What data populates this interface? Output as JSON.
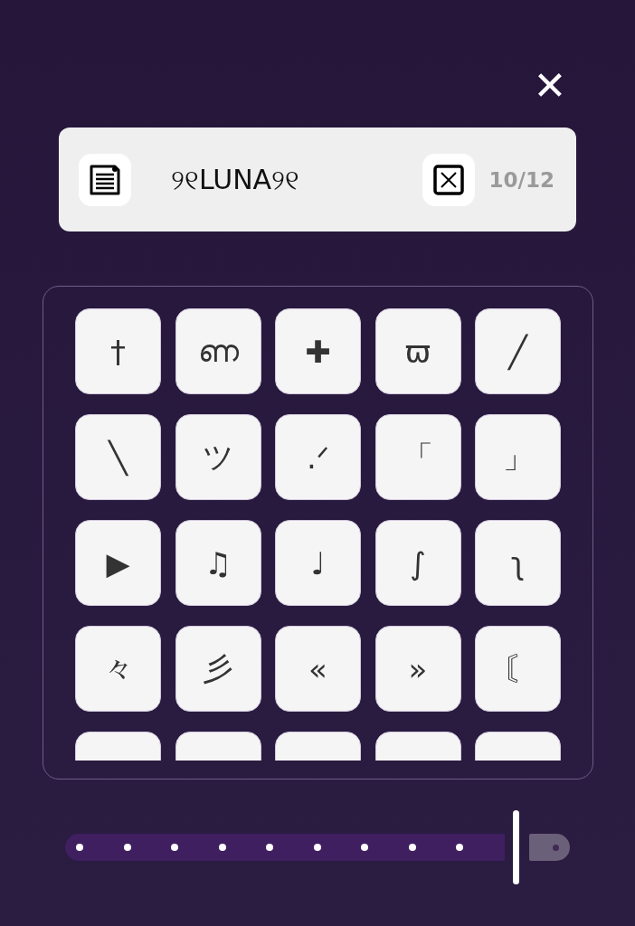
{
  "close_button": {
    "label": "✕"
  },
  "field": {
    "value": "୨୧LUNA୨୧",
    "count": "10/12"
  },
  "keys": [
    {
      "label": "†"
    },
    {
      "label": "ണ"
    },
    {
      "label": "✚"
    },
    {
      "label": "ϖ"
    },
    {
      "label": "╱"
    },
    {
      "label": "╲"
    },
    {
      "label": "ツ"
    },
    {
      "label": ".ᐟ"
    },
    {
      "label": "「"
    },
    {
      "label": "」"
    },
    {
      "label": "▶"
    },
    {
      "label": "♫"
    },
    {
      "label": "♩"
    },
    {
      "label": "∫"
    },
    {
      "label": "ʅ"
    },
    {
      "label": "々"
    },
    {
      "label": "彡"
    },
    {
      "label": "«"
    },
    {
      "label": "»"
    },
    {
      "label": "〘"
    },
    {
      "kind": "cut_off"
    },
    {
      "kind": "cut_off"
    },
    {
      "kind": "cut_off"
    },
    {
      "kind": "cut_off"
    },
    {
      "kind": "cut_off"
    }
  ],
  "slider": {
    "level": 0.9
  }
}
